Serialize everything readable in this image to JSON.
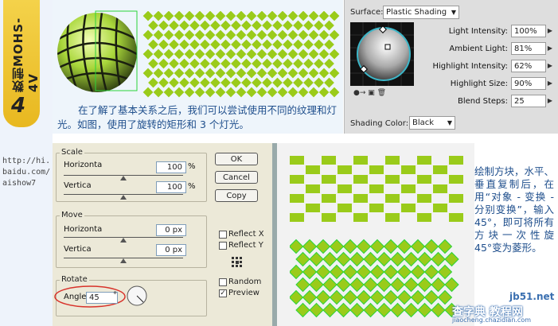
{
  "strip": {
    "title": "数制MOHS-4V",
    "number": "4",
    "url": "http://hi.baidu.com/aishow7"
  },
  "top": {
    "caption": "在了解了基本关系之后，我们可以尝试使用不同的纹理和灯光。如图，使用了旋转的矩形和 3 个灯光。"
  },
  "shading": {
    "surface_label": "Surface:",
    "surface_value": "Plastic Shading",
    "rows": [
      {
        "label": "Light Intensity:",
        "value": "100%"
      },
      {
        "label": "Ambient Light:",
        "value": "81%"
      },
      {
        "label": "Highlight Intensity:",
        "value": "62%"
      },
      {
        "label": "Highlight Size:",
        "value": "90%"
      },
      {
        "label": "Blend Steps:",
        "value": "25"
      }
    ],
    "color_label": "Shading Color:",
    "color_value": "Black"
  },
  "dialog": {
    "scale": {
      "title": "Scale",
      "h_label": "Horizonta",
      "h_value": "100",
      "v_label": "Vertica",
      "v_value": "100",
      "unit": "%"
    },
    "move": {
      "title": "Move",
      "h_label": "Horizonta",
      "h_value": "0 px",
      "v_label": "Vertica",
      "v_value": "0 px"
    },
    "rotate": {
      "title": "Rotate",
      "angle_label": "Angle",
      "angle_value": "45",
      "deg": "°"
    },
    "buttons": {
      "ok": "OK",
      "cancel": "Cancel",
      "copy": "Copy"
    },
    "reflect_x": "Reflect X",
    "reflect_y": "Reflect Y",
    "random": "Random",
    "preview": "Preview"
  },
  "right": {
    "text": "绘制方块，水平、垂直复制后，在用“对象 - 变换 - 分别变换”，输入45°，即可将所有方块一次性旋 45°变为菱形。"
  },
  "watermark": {
    "site": "jb51.net",
    "name": "查字典 教程网",
    "url": "jiaocheng.chazidian.com"
  },
  "colors": {
    "green": "#9acb1a",
    "caption_blue": "#1e4e8c",
    "dialog_bg": "#ece9d8"
  }
}
